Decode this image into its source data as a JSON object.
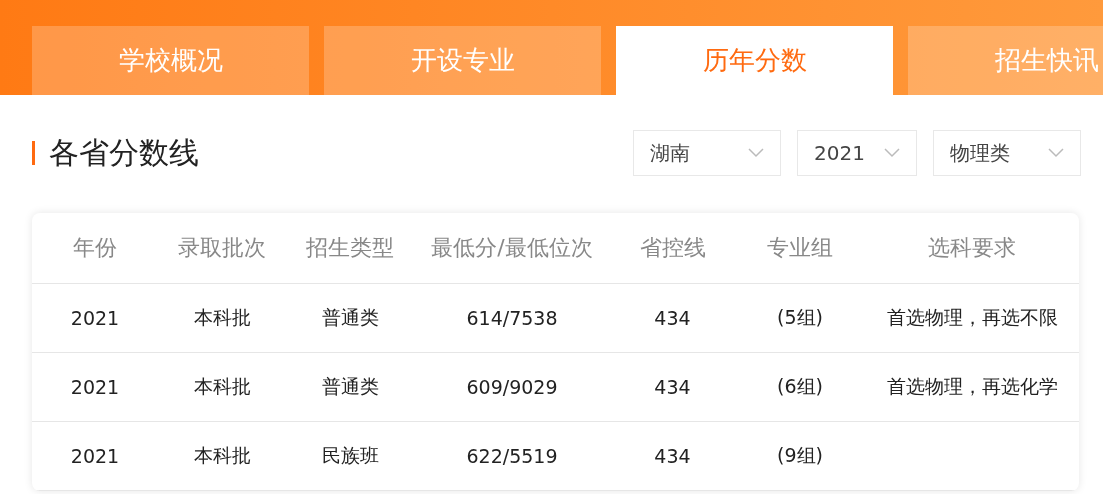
{
  "tabs": [
    {
      "label": "学校概况",
      "selected": false
    },
    {
      "label": "开设专业",
      "selected": false
    },
    {
      "label": "历年分数",
      "selected": true
    },
    {
      "label": "招生快讯",
      "selected": false
    }
  ],
  "section": {
    "title": "各省分数线"
  },
  "filters": [
    {
      "value": "湖南"
    },
    {
      "value": "2021"
    },
    {
      "value": "物理类"
    }
  ],
  "table": {
    "columns": [
      "年份",
      "录取批次",
      "招生类型",
      "最低分/最低位次",
      "省控线",
      "专业组",
      "选科要求"
    ],
    "rows": [
      [
        "2021",
        "本科批",
        "普通类",
        "614/7538",
        "434",
        "(5组)",
        "首选物理，再选不限"
      ],
      [
        "2021",
        "本科批",
        "普通类",
        "609/9029",
        "434",
        "(6组)",
        "首选物理，再选化学"
      ],
      [
        "2021",
        "本科批",
        "民族班",
        "622/5519",
        "434",
        "(9组)"
      ]
    ]
  }
}
